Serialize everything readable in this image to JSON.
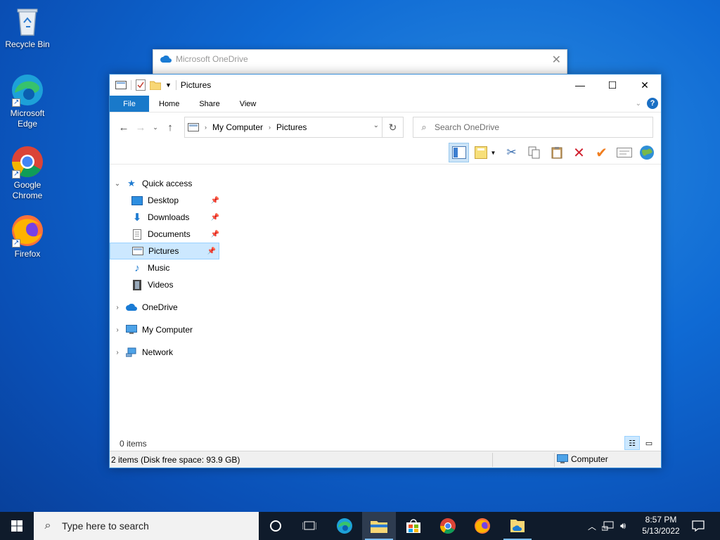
{
  "desktop": {
    "icons": [
      {
        "label": "Recycle Bin"
      },
      {
        "label": "Microsoft Edge"
      },
      {
        "label": "Google Chrome"
      },
      {
        "label": "Firefox"
      }
    ]
  },
  "onedrive_window": {
    "title": "Microsoft OneDrive"
  },
  "explorer": {
    "title": "Pictures",
    "tabs": {
      "file": "File",
      "home": "Home",
      "share": "Share",
      "view": "View"
    },
    "address": {
      "root": "My Computer",
      "current": "Pictures"
    },
    "search_placeholder": "Search OneDrive",
    "nav": {
      "quick_access": "Quick access",
      "desktop": "Desktop",
      "downloads": "Downloads",
      "documents": "Documents",
      "pictures": "Pictures",
      "music": "Music",
      "videos": "Videos",
      "onedrive": "OneDrive",
      "my_computer": "My Computer",
      "network": "Network"
    },
    "item_count": "0 items",
    "status_left": "2 items (Disk free space: 93.9 GB)",
    "status_right": "Computer"
  },
  "taskbar": {
    "search_placeholder": "Type here to search",
    "time": "8:57 PM",
    "date": "5/13/2022"
  },
  "colors": {
    "accent": "#1979ca",
    "taskbar": "#0f1b2b"
  }
}
